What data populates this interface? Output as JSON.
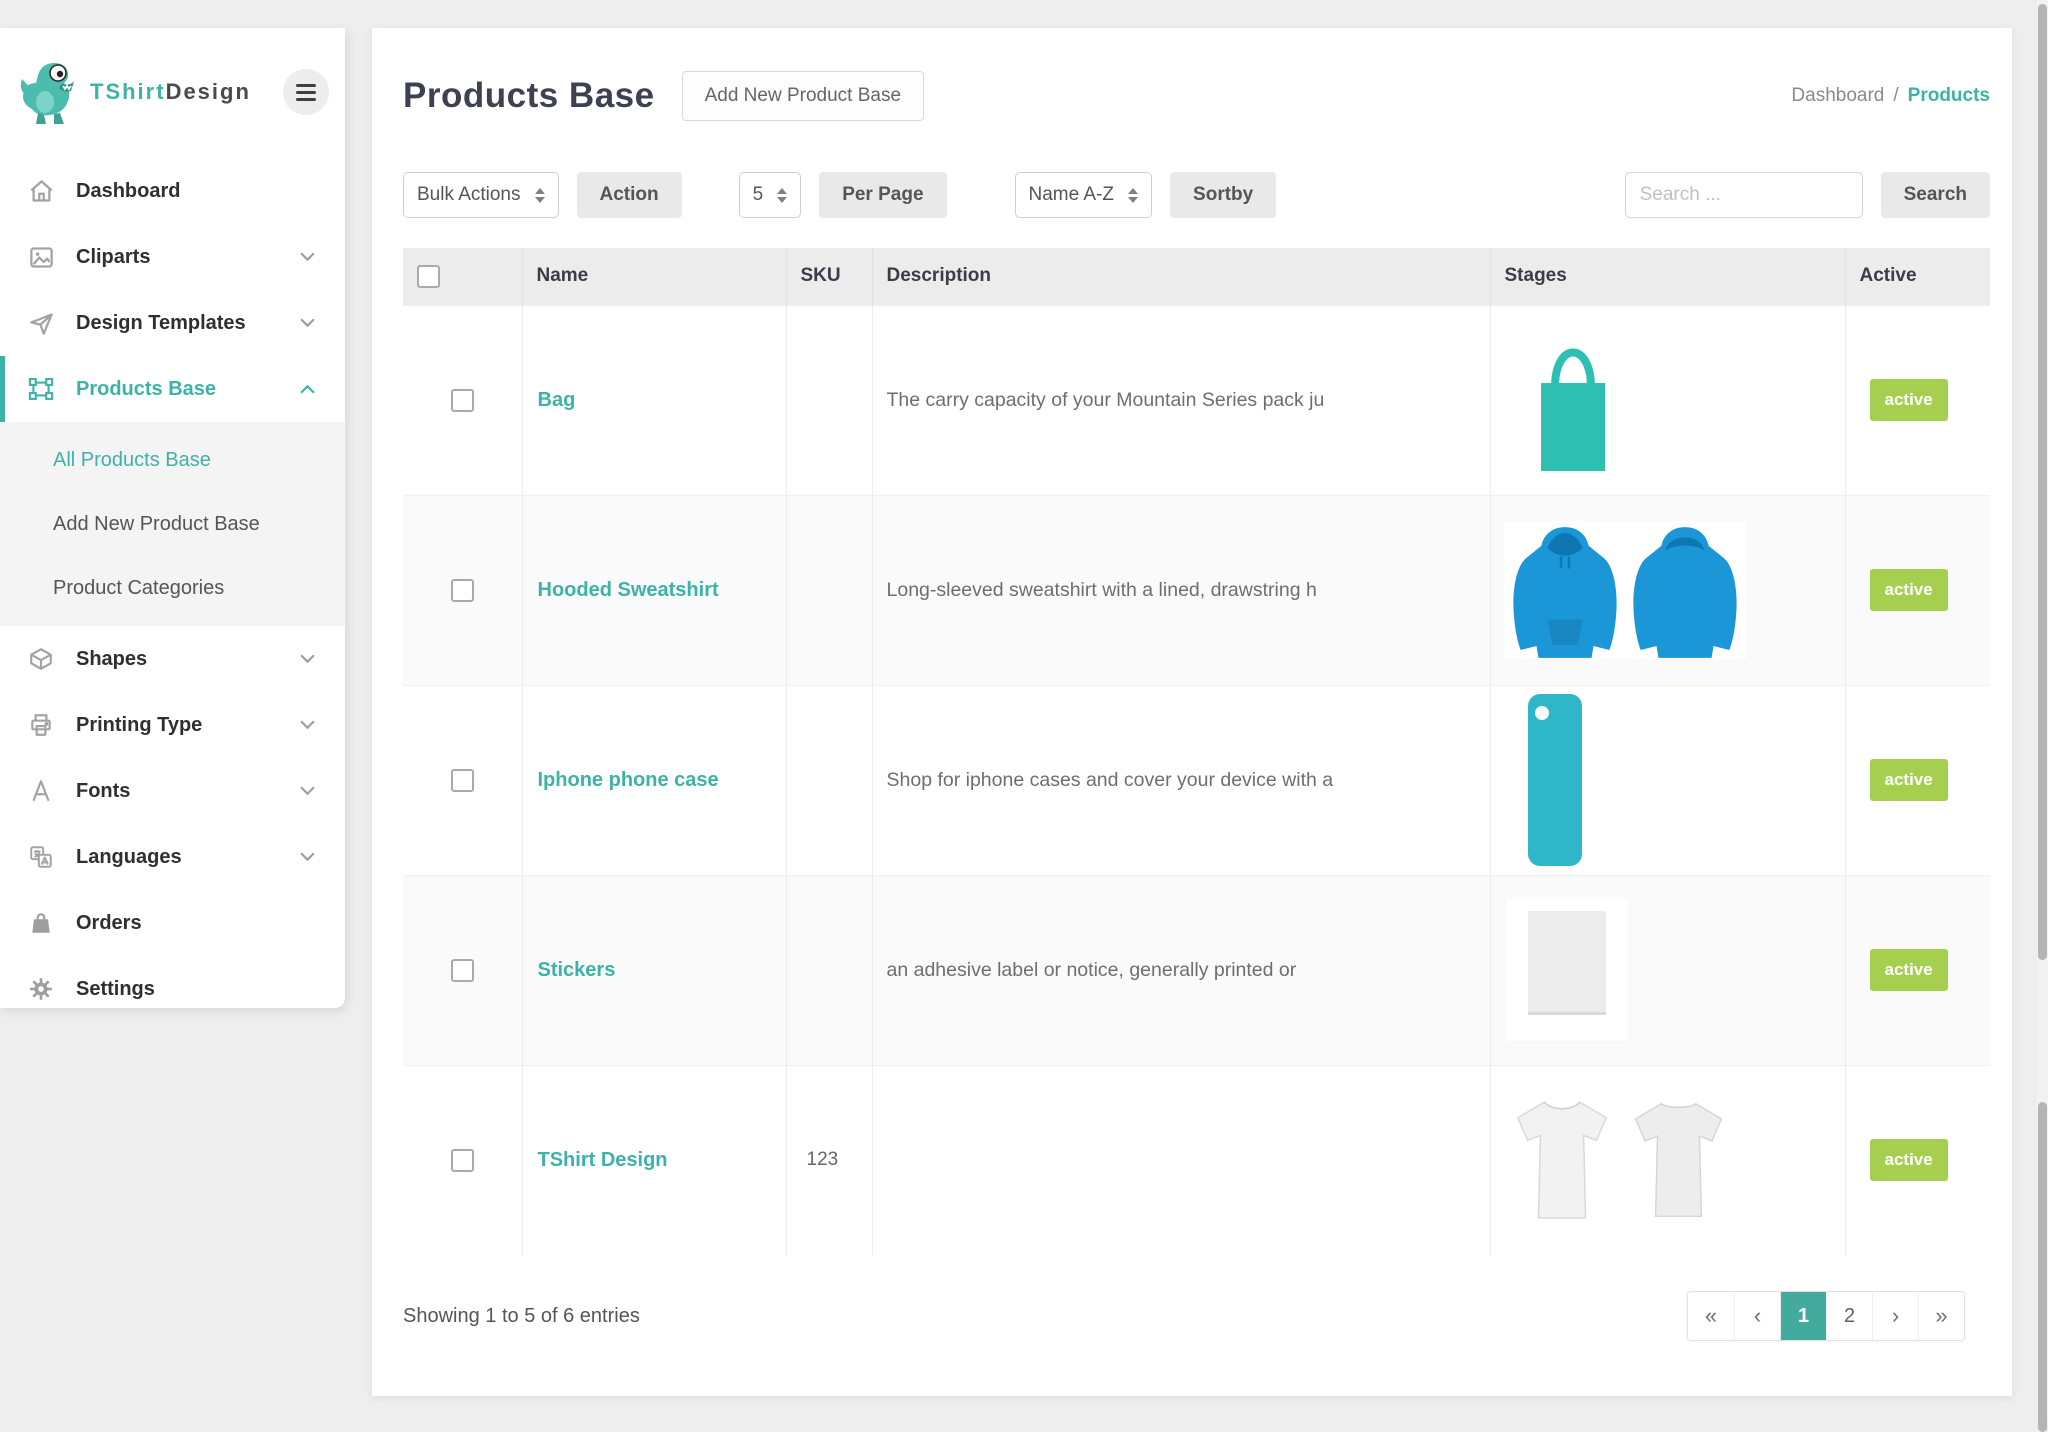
{
  "brand": {
    "name_teal": "TShirt",
    "name_dark": "Design"
  },
  "sidebar": {
    "items": [
      {
        "label": "Dashboard"
      },
      {
        "label": "Cliparts"
      },
      {
        "label": "Design Templates"
      },
      {
        "label": "Products Base"
      },
      {
        "label": "Shapes"
      },
      {
        "label": "Printing Type"
      },
      {
        "label": "Fonts"
      },
      {
        "label": "Languages"
      },
      {
        "label": "Orders"
      },
      {
        "label": "Settings"
      }
    ],
    "products_submenu": [
      {
        "label": "All Products Base"
      },
      {
        "label": "Add New Product Base"
      },
      {
        "label": "Product Categories"
      }
    ]
  },
  "header": {
    "title": "Products Base",
    "add_button_label": "Add New Product Base",
    "breadcrumb": {
      "parent": "Dashboard",
      "separator": "/",
      "current": "Products"
    }
  },
  "toolbar": {
    "bulk_actions_value": "Bulk Actions",
    "action_label": "Action",
    "per_page_value": "5",
    "per_page_label": "Per Page",
    "sort_value": "Name A-Z",
    "sortby_label": "Sortby",
    "search_placeholder": "Search ...",
    "search_label": "Search"
  },
  "table": {
    "columns": {
      "name": "Name",
      "sku": "SKU",
      "description": "Description",
      "stages": "Stages",
      "active": "Active"
    },
    "rows": [
      {
        "name": "Bag",
        "sku": "",
        "description": "The carry capacity of your Mountain Series pack ju",
        "stage_icon": "tote-bag",
        "active_label": "active"
      },
      {
        "name": "Hooded Sweatshirt",
        "sku": "",
        "description": "Long-sleeved sweatshirt with a lined, drawstring h",
        "stage_icon": "hoodie-front-back",
        "active_label": "active"
      },
      {
        "name": "Iphone phone case",
        "sku": "",
        "description": "Shop for iphone cases and cover your device with a",
        "stage_icon": "phone-case",
        "active_label": "active"
      },
      {
        "name": "Stickers",
        "sku": "",
        "description": "an adhesive label or notice, generally printed or",
        "stage_icon": "sticker-sheet",
        "active_label": "active"
      },
      {
        "name": "TShirt Design",
        "sku": "123",
        "description": "",
        "stage_icon": "tshirt-front-back",
        "active_label": "active"
      }
    ]
  },
  "footer": {
    "summary": "Showing 1 to 5 of 6 entries",
    "pagination": {
      "first": "«",
      "prev": "‹",
      "page1": "1",
      "page2": "2",
      "next": "›",
      "last": "»"
    },
    "active_page": "1"
  },
  "colors": {
    "accent": "#3cb3a6",
    "accent_dark": "#44aa9d",
    "badge_green": "#a6ce4f",
    "hoodie_blue": "#1b97d8",
    "case_cyan": "#30b6c9",
    "tote_teal": "#2dc0b2"
  }
}
